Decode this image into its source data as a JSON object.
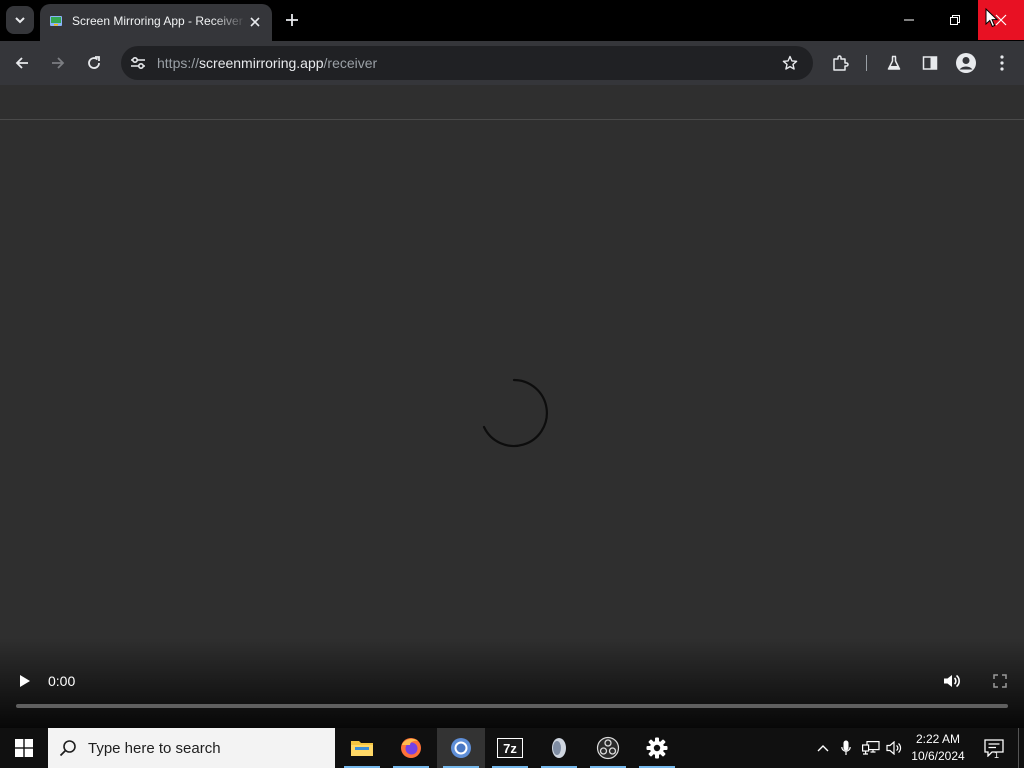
{
  "browser": {
    "tab": {
      "title": "Screen Mirroring App - Receiver"
    },
    "address": {
      "scheme": "https://",
      "host": "screenmirroring.app",
      "path": "/receiver"
    }
  },
  "video_player": {
    "current_time": "0:00",
    "progress": 0
  },
  "taskbar": {
    "search_placeholder": "Type here to search",
    "apps": [
      {
        "name": "file-explorer-icon",
        "running": true,
        "active": false
      },
      {
        "name": "firefox-icon",
        "running": true,
        "active": false
      },
      {
        "name": "chrome-icon",
        "running": true,
        "active": true
      },
      {
        "name": "7zip-icon",
        "running": true,
        "active": false
      },
      {
        "name": "app-icon",
        "running": true,
        "active": false
      },
      {
        "name": "obs-icon",
        "running": true,
        "active": false
      },
      {
        "name": "settings-gear-icon",
        "running": true,
        "active": false
      }
    ],
    "clock": {
      "time": "2:22 AM",
      "date": "10/6/2024"
    },
    "notification_count": "1"
  },
  "colors": {
    "titlebar": "#000000",
    "toolbar": "#35363a",
    "page_background": "#2f2f2f",
    "close_hover": "#e81123",
    "taskbar": "#101010"
  }
}
